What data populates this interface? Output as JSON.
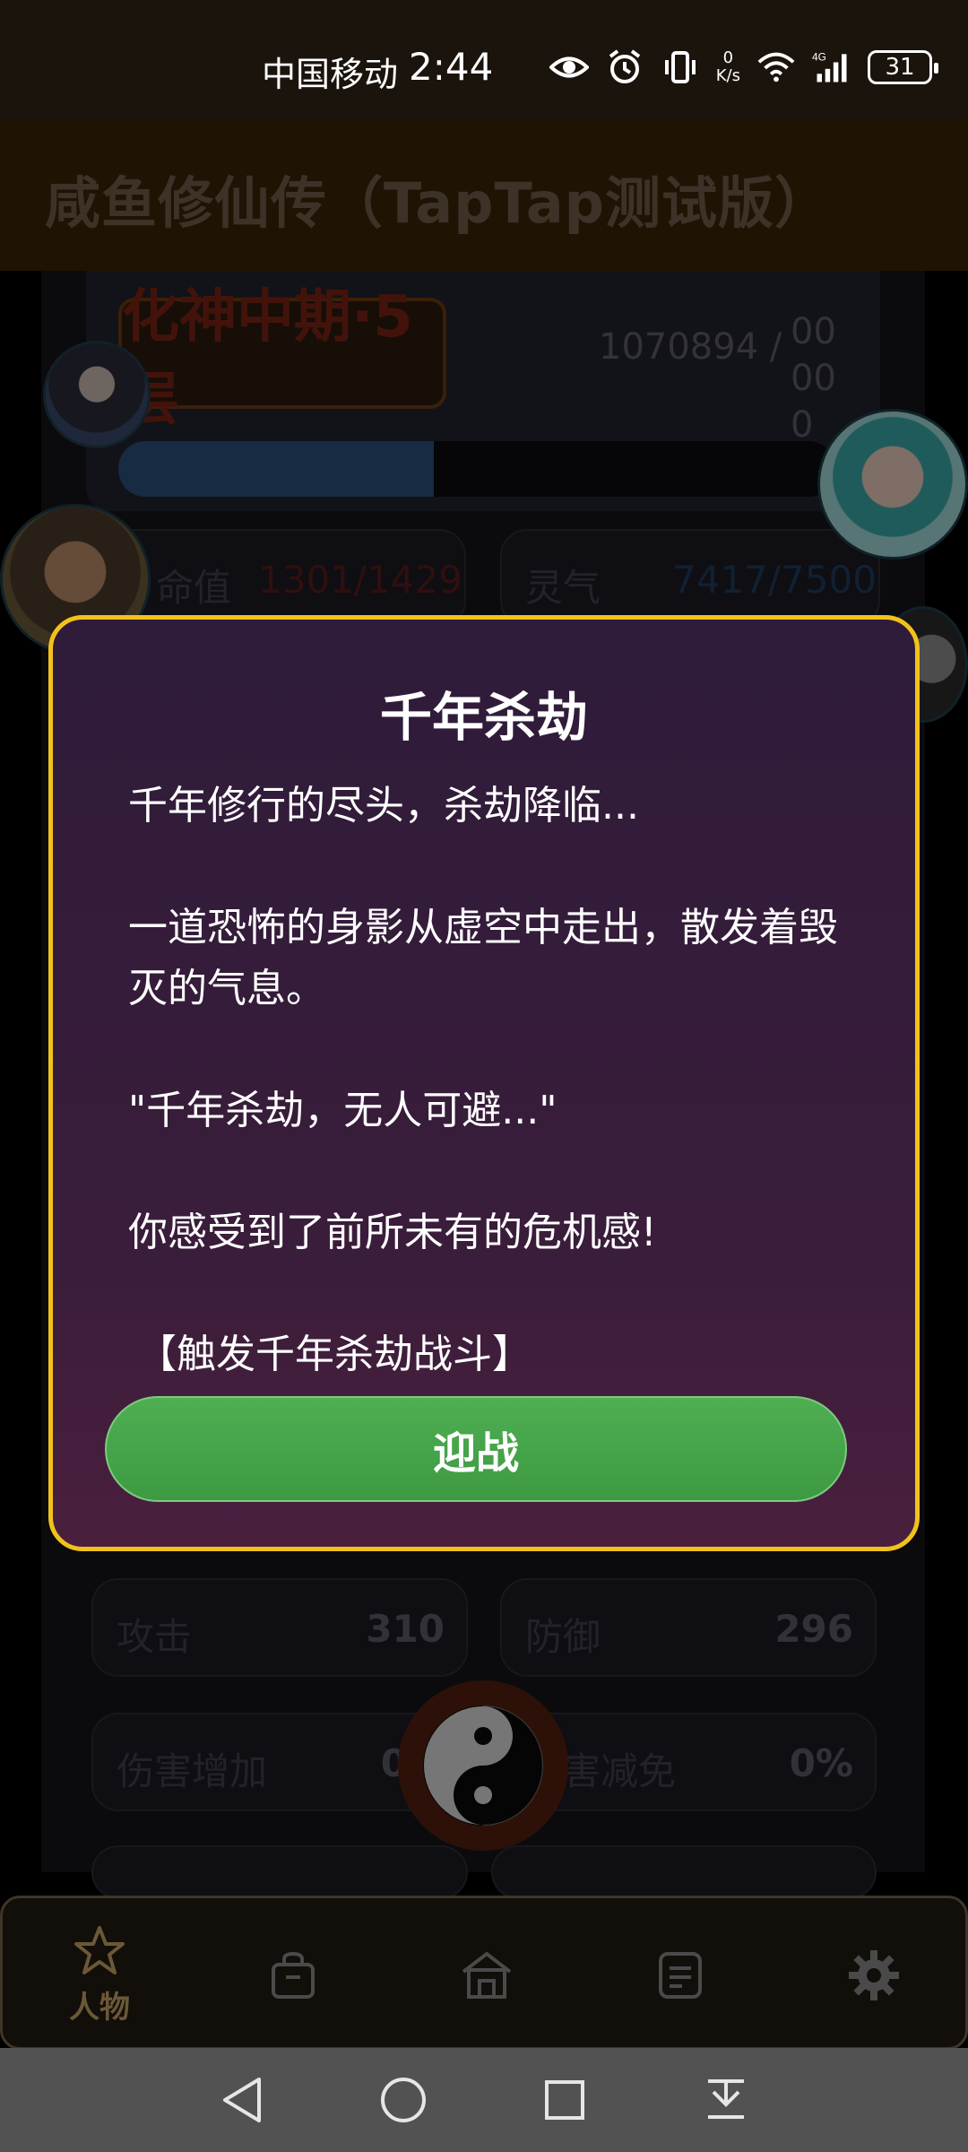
{
  "status_bar": {
    "carrier": "中国移动",
    "time": "2:44",
    "net_speed_value": "0",
    "net_speed_unit": "K/s",
    "network_type": "4G",
    "battery": "31",
    "icons": [
      "eye-icon",
      "alarm-icon",
      "vibrate-icon",
      "wifi-icon",
      "signal-icon",
      "battery-icon"
    ]
  },
  "app": {
    "title": "咸鱼修仙传（TapTap测试版）"
  },
  "character": {
    "realm": "化神中期·5层",
    "exp_current": "1070894 /",
    "exp_tail": "00 00 0",
    "progress": 0.44,
    "stats": [
      {
        "label": "命值",
        "value": "1301/1429"
      },
      {
        "label": "灵气",
        "value": "7417/7500"
      },
      {
        "label": "攻击",
        "value": "310"
      },
      {
        "label": "防御",
        "value": "296"
      },
      {
        "label": "伤害增加",
        "value": "0%"
      },
      {
        "label": "伤害减免",
        "value": "0%"
      }
    ]
  },
  "dialog": {
    "title": "千年杀劫",
    "line1": "千年修行的尽头，杀劫降临...",
    "line2": "一道恐怖的身影从虚空中走出，散发着毁灭的气息。",
    "line3": "\"千年杀劫，无人可避...\"",
    "line4": "你感受到了前所未有的危机感!",
    "line5": "【触发千年杀劫战斗】",
    "button": "迎战"
  },
  "tabbar": {
    "tabs": [
      {
        "icon": "star-icon",
        "label": "人物",
        "active": true
      },
      {
        "icon": "bag-icon",
        "label": "",
        "active": false
      },
      {
        "icon": "home-icon",
        "label": "",
        "active": false
      },
      {
        "icon": "list-icon",
        "label": "",
        "active": false
      },
      {
        "icon": "gear-icon",
        "label": "",
        "active": false
      }
    ]
  },
  "navbar": {
    "buttons": [
      "back-icon",
      "home-circle-icon",
      "recents-icon",
      "notifications-icon"
    ]
  },
  "colors": {
    "dialog_border": "#f2c21b",
    "accept_button": "#4fae52",
    "header_bg": "#3a2407",
    "tab_active": "#6b5836"
  }
}
